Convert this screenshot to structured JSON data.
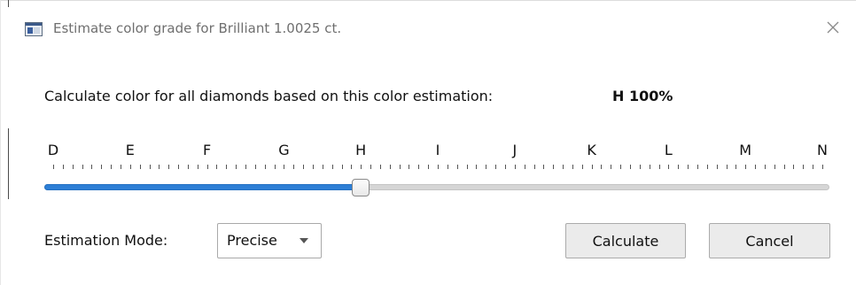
{
  "window": {
    "title": "Estimate color grade for Brilliant 1.0025 ct.",
    "icon": "app-window-icon",
    "close_icon": "close-icon"
  },
  "prompt": {
    "text": "Calculate color for all diamonds based on this color estimation:",
    "estimate": "H 100%"
  },
  "slider": {
    "grades": [
      "D",
      "E",
      "F",
      "G",
      "H",
      "I",
      "J",
      "K",
      "L",
      "M",
      "N"
    ],
    "selected_grade": "H",
    "selected_fraction": 0.4,
    "accent_color": "#2d7fd6"
  },
  "mode": {
    "label": "Estimation Mode:",
    "selected": "Precise"
  },
  "buttons": {
    "calculate": "Calculate",
    "cancel": "Cancel"
  }
}
